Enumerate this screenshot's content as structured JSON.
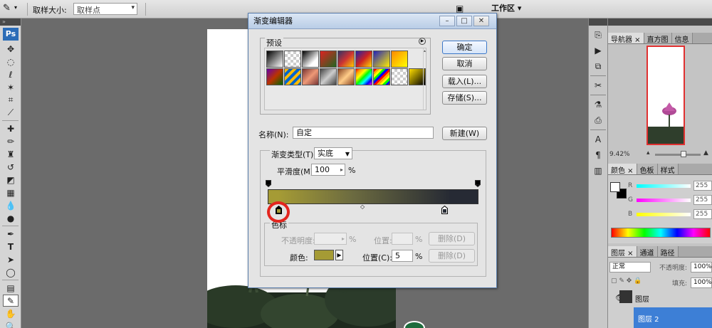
{
  "optionsbar": {
    "sample_size_label": "取样大小:",
    "sample_size_value": "取样点",
    "workspace_label": "工作区"
  },
  "tools": {
    "ps_logo": "Ps"
  },
  "panels": {
    "navigator_tabs": [
      "导航器",
      "直方图",
      "信息"
    ],
    "zoom": "9.42%",
    "color_tabs": [
      "颜色",
      "色板",
      "样式"
    ],
    "color_sliders": [
      {
        "label": "R",
        "value": "255"
      },
      {
        "label": "G",
        "value": "255"
      },
      {
        "label": "B",
        "value": "255"
      }
    ],
    "layers_tabs": [
      "图层",
      "通道",
      "路径"
    ],
    "blend_mode": "正常",
    "opacity_label": "不透明度:",
    "opacity_value": "100%",
    "fill_label": "填充:",
    "fill_value": "100%",
    "layer_name": "图层 2",
    "layer_name_top": "图层"
  },
  "dialog": {
    "title": "渐变编辑器",
    "presets_label": "预设",
    "ok": "确定",
    "cancel": "取消",
    "load": "载入(L)...",
    "save": "存储(S)...",
    "name_label": "名称(N):",
    "name_value": "自定",
    "new_button": "新建(W)",
    "gradient_type_label": "渐变类型(T):",
    "gradient_type_value": "实底",
    "smoothness_label": "平滑度(M):",
    "smoothness_value": "100",
    "percent": "%",
    "stops_group_label": "色标",
    "opacity_label": "不透明度:",
    "location_label": "位置:",
    "delete_label": "删除(D)",
    "color_label": "颜色:",
    "location_c_label": "位置(C):",
    "location_c_value": "5",
    "delete2_label": "删除(D)"
  },
  "colors": {
    "stop_start": "#a59b35",
    "stop_end": "#262a34",
    "highlight": "#e3251e"
  }
}
